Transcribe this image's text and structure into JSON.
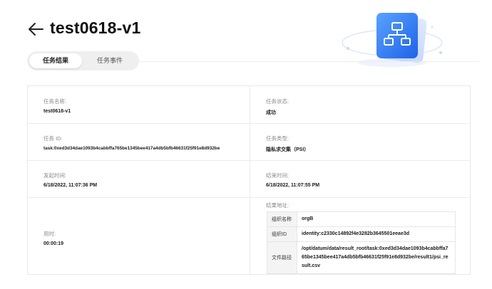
{
  "header": {
    "title": "test0618-v1"
  },
  "tabs": [
    {
      "label": "任务结果",
      "active": true
    },
    {
      "label": "任务事件",
      "active": false
    }
  ],
  "fields": {
    "task_name": {
      "label": "任务名称:",
      "value": "test0618-v1"
    },
    "task_status": {
      "label": "任务状态:",
      "value": "成功"
    },
    "task_id": {
      "label": "任务 ID:",
      "value": "task:0xed3d34dae1093b4cabbffa765be1345bee417a4db5bfb46631f25f91e8d932be"
    },
    "task_type": {
      "label": "任务类型:",
      "value": "隐私求交集（PSI）"
    },
    "start_time": {
      "label": "发起时间:",
      "value": "6/18/2022, 11:07:36 PM"
    },
    "end_time": {
      "label": "结束时间:",
      "value": "6/18/2022, 11:07:55 PM"
    },
    "duration": {
      "label": "用时:",
      "value": "00:00:19"
    },
    "result_address": {
      "label": "结果地址:"
    }
  },
  "result_table": {
    "rows": [
      {
        "key": "组织名称",
        "value": "orgB"
      },
      {
        "key": "组织ID",
        "value": "identity:c2330c14892f4e3282b3645501eeae3d"
      },
      {
        "key": "文件路径",
        "value": "/opt/datum/data/result_root/task:0xed3d34dae1093b4cabbffa765be1345bee417a4db5bfb46631f25f91e8d932be/result1/psi_result.csv"
      }
    ]
  },
  "colors": {
    "accent_blue": "#2f7df6",
    "border": "#e8e8e8",
    "label_gray": "#8a8a8a"
  },
  "icons": {
    "back": "arrow-left-icon",
    "hero": "workflow-tree-icon"
  }
}
